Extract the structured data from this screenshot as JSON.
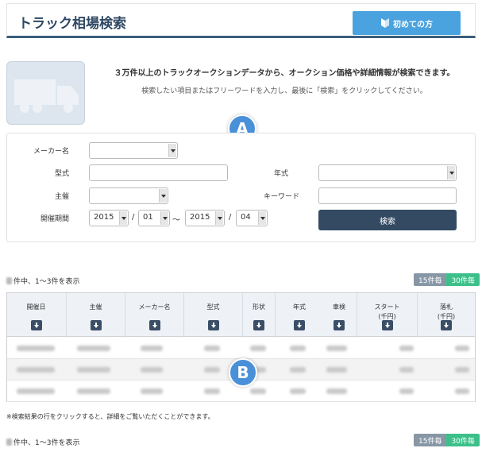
{
  "header": {
    "title": "トラック相場検索",
    "beginner_button": "初めての方"
  },
  "intro": {
    "main": "３万件以上のトラックオークションデータから、オークション価格や詳細情報が検索できます。",
    "sub": "検索したい項目またはフリーワードを入力し、最後に「検索」をクリックしてください。"
  },
  "badges": {
    "a": "A",
    "b": "B"
  },
  "form": {
    "maker_label": "メーカー名",
    "model_label": "型式",
    "year_label": "年式",
    "organizer_label": "主催",
    "keyword_label": "キーワード",
    "period_label": "開催期間",
    "period_from_year": "2015",
    "period_from_month": "01",
    "period_to_year": "2015",
    "period_to_month": "04",
    "slash": "/",
    "tilde": "～",
    "search_button": "検索"
  },
  "results": {
    "count_text": "件中、1～3件を表示",
    "per_page_15": "15件毎",
    "per_page_30": "30件毎",
    "columns": [
      {
        "line1": "開催日",
        "line2": ""
      },
      {
        "line1": "主催",
        "line2": ""
      },
      {
        "line1": "メーカー名",
        "line2": ""
      },
      {
        "line1": "型式",
        "line2": ""
      },
      {
        "line1": "形状",
        "line2": ""
      },
      {
        "line1": "年式",
        "line2": ""
      },
      {
        "line1": "車検",
        "line2": ""
      },
      {
        "line1": "スタート",
        "line2": "(千円)"
      },
      {
        "line1": "落札",
        "line2": "(千円)"
      }
    ],
    "note": "※検索結果の行をクリックすると、詳細をご覧いただくことができます。"
  },
  "colors": {
    "header_accent": "#3a5e7d",
    "beginner": "#4aa3df",
    "search_button": "#344a63",
    "active_per_page": "#3cc08a",
    "badge": "#4a90d9"
  }
}
